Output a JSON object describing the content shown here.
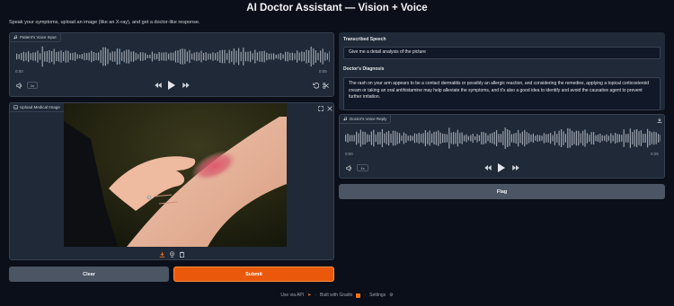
{
  "header": {
    "title": "AI Doctor Assistant — Vision + Voice",
    "subtitle": "Speak your symptoms, upload an image (like an X-ray), and get a doctor-like response."
  },
  "voice_input": {
    "label": "Patient's Voice Input",
    "time_start": "0:00",
    "time_end": "0:05",
    "speed": "1x"
  },
  "image_upload": {
    "label": "Upload Medical Image"
  },
  "transcribed": {
    "label": "Transcribed Speech",
    "value": "Give me a detail analysis of the picture"
  },
  "diagnosis": {
    "label": "Doctor's Diagnosis",
    "value": "The rash on your arm appears to be a contact dermatitis or possibly an allergic reaction, and considering the remedies, applying a topical corticosteroid cream or taking an oral antihistamine may help alleviate the symptoms, and it's also a good idea to identify and avoid the causative agent to prevent further irritation."
  },
  "voice_reply": {
    "label": "Doctor's Voice Reply",
    "time_start": "0:00",
    "time_end": "0:25",
    "speed": "1x"
  },
  "buttons": {
    "clear": "Clear",
    "submit": "Submit",
    "flag": "Flag"
  },
  "footer": {
    "api": "Use via API",
    "built": "Built with Gradio",
    "settings": "Settings",
    "dot": "·"
  },
  "colors": {
    "background": "#0b0f19",
    "panel": "#1f2937",
    "submit": "#ea580c",
    "secondary_button": "#4b5563"
  }
}
